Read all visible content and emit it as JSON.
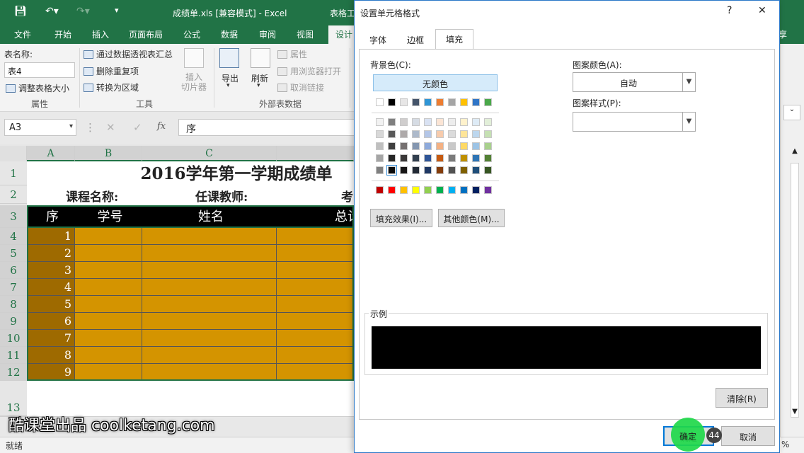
{
  "title_bar": {
    "title": "成绩单.xls  [兼容模式] - Excel",
    "context": "表格工"
  },
  "tabs": [
    "文件",
    "开始",
    "插入",
    "页面布局",
    "公式",
    "数据",
    "审阅",
    "视图",
    "设计"
  ],
  "ribbon_right": "享",
  "ribbon": {
    "table_name_label": "表名称:",
    "table_name_value": "表4",
    "resize_table": "调整表格大小",
    "group_properties": "属性",
    "summarize_pivot": "通过数据透视表汇总",
    "remove_duplicates": "删除重复项",
    "convert_range": "转换为区域",
    "group_tools": "工具",
    "insert_slicer": "插入\n切片器",
    "export": "导出",
    "refresh": "刷新",
    "properties": "属性",
    "open_browser": "用浏览器打开",
    "unlink": "取消链接",
    "group_external": "外部表数据"
  },
  "formula_bar": {
    "name_box": "A3",
    "fx": "fx",
    "content": "序"
  },
  "grid": {
    "columns": [
      "A",
      "B",
      "C"
    ],
    "rows": [
      "1",
      "2",
      "3",
      "4",
      "5",
      "6",
      "7",
      "8",
      "9",
      "10",
      "11",
      "12",
      "13"
    ],
    "title": "2016学年第一学期成绩单",
    "course_label": "课程名称:",
    "teacher_label": "任课教师:",
    "exam_label": "考",
    "headers": [
      "序",
      "学号",
      "姓名",
      "总计"
    ],
    "numbers": [
      "1",
      "2",
      "3",
      "4",
      "5",
      "6",
      "7",
      "8",
      "9"
    ]
  },
  "status": "就绪",
  "zoom_fragment": "%",
  "dialog": {
    "title": "设置单元格格式",
    "help": "?",
    "close": "✕",
    "tabs": [
      "字体",
      "边框",
      "填充"
    ],
    "active_tab": "填充",
    "bg_color_label": "背景色(C):",
    "no_color": "无颜色",
    "pattern_color_label": "图案颜色(A):",
    "pattern_color_value": "自动",
    "pattern_style_label": "图案样式(P):",
    "fill_effects": "填充效果(I)...",
    "more_colors": "其他颜色(M)...",
    "sample_label": "示例",
    "sample_color": "#000000",
    "clear": "清除(R)",
    "ok": "确定",
    "cancel": "取消",
    "theme_colors_top": [
      "#ffffff",
      "#000000",
      "#e7e6e6",
      "#44546a",
      "#4472c4",
      "#ed7d31",
      "#a5a5a5",
      "#ffc000",
      "#5b9bd5",
      "#70ad47"
    ],
    "theme_colors_top_actual": [
      "#ffffff",
      "#000000",
      "#e7e6e6",
      "#44546a",
      "#2e75b6",
      "#ed7d31",
      "#a5a5a5",
      "#ffc000",
      "#2f75c7",
      "#4aa84a"
    ],
    "standard_colors": [
      "#c00000",
      "#ff0000",
      "#ffc000",
      "#ffff00",
      "#92d050",
      "#00b050",
      "#00b0f0",
      "#0070c0",
      "#002060",
      "#7030a0"
    ]
  },
  "watermark": "酷课堂出品 coolketang.com",
  "badge_number": "44"
}
